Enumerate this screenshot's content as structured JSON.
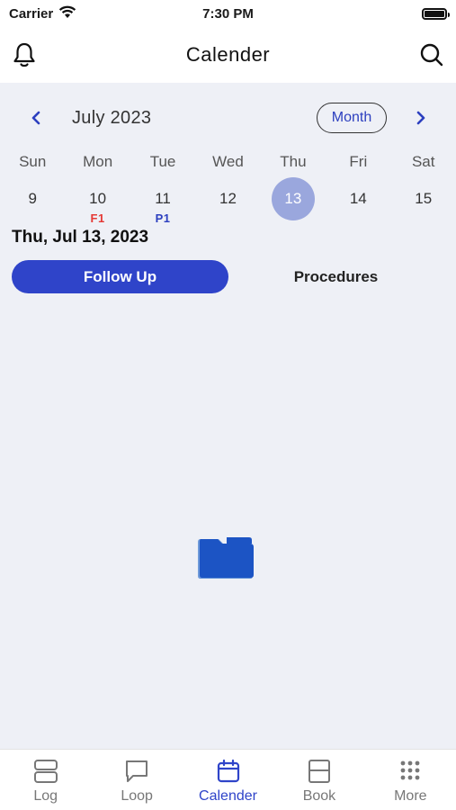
{
  "status_bar": {
    "carrier": "Carrier",
    "time": "7:30 PM"
  },
  "header": {
    "title": "Calender",
    "left_icon": "bell-icon",
    "right_icon": "search-icon"
  },
  "calendar": {
    "month_title": "July 2023",
    "view_button_label": "Month",
    "weekdays": [
      "Sun",
      "Mon",
      "Tue",
      "Wed",
      "Thu",
      "Fri",
      "Sat"
    ],
    "dates": [
      {
        "day": "9",
        "badge": ""
      },
      {
        "day": "10",
        "badge": "F1"
      },
      {
        "day": "11",
        "badge": "P1"
      },
      {
        "day": "12",
        "badge": ""
      },
      {
        "day": "13",
        "badge": ""
      },
      {
        "day": "14",
        "badge": ""
      },
      {
        "day": "15",
        "badge": ""
      }
    ],
    "selected_day": "13",
    "selected_date_label": "Thu, Jul 13, 2023"
  },
  "tabs": {
    "follow_up": "Follow Up",
    "procedures": "Procedures",
    "active": "follow_up"
  },
  "empty_state": {
    "icon": "folder-icon"
  },
  "tabbar": {
    "items": [
      {
        "label": "Log",
        "icon": "log-icon"
      },
      {
        "label": "Loop",
        "icon": "chat-bubble-icon"
      },
      {
        "label": "Calender",
        "icon": "calendar-icon"
      },
      {
        "label": "Book",
        "icon": "book-icon"
      },
      {
        "label": "More",
        "icon": "grid-dots-icon"
      }
    ],
    "active_index": 2
  },
  "colors": {
    "accent": "#2f44c9",
    "selected_date_bg": "#9aa7dd",
    "badge_red": "#e53935",
    "badge_blue": "#2c3fbf",
    "background": "#eef0f6",
    "folder": "#1c54c4"
  }
}
